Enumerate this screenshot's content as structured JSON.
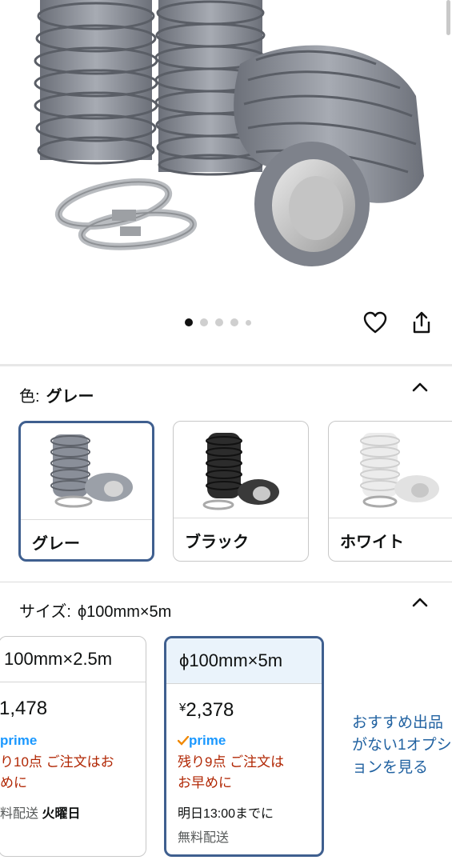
{
  "carousel": {
    "slide_count": 5,
    "active_index": 0
  },
  "color_section": {
    "label": "色:",
    "selected_value": "グレー",
    "options": [
      {
        "label": "グレー",
        "tone": "#8a8f99",
        "selected": true
      },
      {
        "label": "ブラック",
        "tone": "#2c2c2c",
        "selected": false
      },
      {
        "label": "ホワイト",
        "tone": "#e6e6e6",
        "selected": false
      }
    ]
  },
  "size_section": {
    "label": "サイズ:",
    "selected_value": "ϕ100mm×5m",
    "options": [
      {
        "title": "100mm×2.5m",
        "price_symbol": "",
        "price": "1,478",
        "prime": "prime",
        "stock_line1": "り10点 ご注文はお",
        "stock_line2": "めに",
        "ship_prefix": "料配送",
        "ship_day": "火曜日",
        "selected": false
      },
      {
        "title": "ϕ100mm×5m",
        "price_symbol": "¥",
        "price": "2,378",
        "prime": "prime",
        "stock_line1": "残り9点 ご注文は",
        "stock_line2": "お早めに",
        "ship_prefix": "明日13:00までに",
        "ship_day": "",
        "ship_free": "無料配送",
        "selected": true
      }
    ],
    "recommendation": "おすすめ出品がない1オプションを見る"
  },
  "icons": [
    "heart-icon",
    "share-icon",
    "chevron-up-icon",
    "prime-check-icon"
  ],
  "colors": {
    "selected_border": "#3f5f8f",
    "link": "#2162a1",
    "stock_warning": "#b12704",
    "prime_blue": "#1a98ff",
    "prime_check": "#f08804"
  }
}
